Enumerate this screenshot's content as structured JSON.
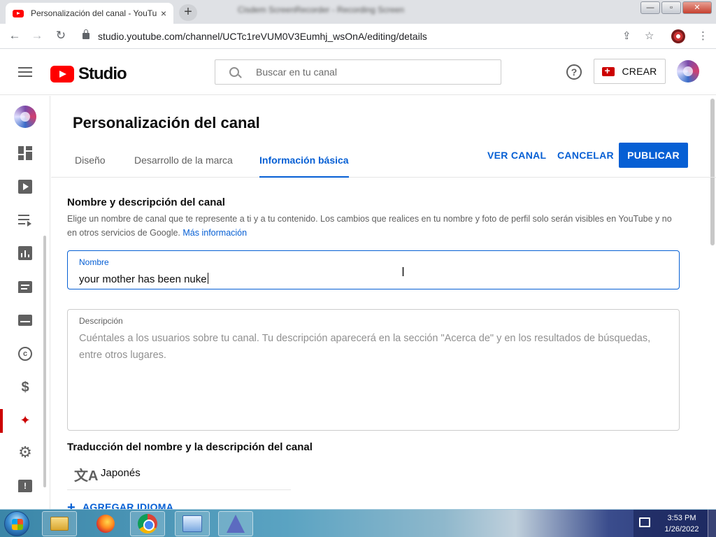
{
  "browser": {
    "tab_title": "Personalización del canal - YouTube",
    "tab_close": "×",
    "new_tab": "+",
    "window_title": "Cisdem ScreenRecorder - Recording Screen",
    "win_min": "—",
    "win_max": "▫",
    "win_close": "✕",
    "back": "←",
    "forward": "→",
    "reload": "↻",
    "url": "studio.youtube.com/channel/UCTc1reVUM0V3Eumhj_wsOnA/editing/details",
    "share_icon": "⇪",
    "star_icon": "☆",
    "menu_icon": "⋮"
  },
  "header": {
    "logo_text": "Studio",
    "search_placeholder": "Buscar en tu canal",
    "help": "?",
    "create_label": "CREAR"
  },
  "rail": {
    "items": [
      {
        "name": "panel",
        "icon": "dashboard-icon"
      },
      {
        "name": "contenido",
        "icon": "content-icon"
      },
      {
        "name": "listas",
        "icon": "playlists-icon"
      },
      {
        "name": "estadisticas",
        "icon": "analytics-icon"
      },
      {
        "name": "comentarios",
        "icon": "comments-icon"
      },
      {
        "name": "subtitulos",
        "icon": "subtitles-icon"
      },
      {
        "name": "derechos",
        "icon": "copyright-icon",
        "glyph": "c"
      },
      {
        "name": "ingresos",
        "icon": "monetization-icon",
        "glyph": "$"
      },
      {
        "name": "personalizacion",
        "icon": "customization-icon",
        "active": true,
        "glyph": "✦"
      },
      {
        "name": "configuracion",
        "icon": "settings-icon",
        "glyph": "⚙"
      },
      {
        "name": "comentarios-enviar",
        "icon": "feedback-icon",
        "glyph": "!"
      }
    ]
  },
  "page": {
    "title": "Personalización del canal",
    "tabs": [
      {
        "label": "Diseño",
        "active": false
      },
      {
        "label": "Desarrollo de la marca",
        "active": false
      },
      {
        "label": "Información básica",
        "active": true
      }
    ],
    "actions": {
      "view_channel": "VER CANAL",
      "cancel": "CANCELAR",
      "publish": "PUBLICAR"
    },
    "section": {
      "title": "Nombre y descripción del canal",
      "description": "Elige un nombre de canal que te represente a ti y a tu contenido. Los cambios que realices en tu nombre y foto de perfil solo serán visibles en YouTube y no en otros servicios de Google.",
      "link": "Más información"
    },
    "name_field": {
      "label": "Nombre",
      "value": "your mother has been nuke"
    },
    "description_field": {
      "label": "Descripción",
      "placeholder": "Cuéntales a los usuarios sobre tu canal. Tu descripción aparecerá en la sección \"Acerca de\" y en los resultados de búsquedas, entre otros lugares."
    },
    "translation": {
      "title": "Traducción del nombre y la descripción del canal",
      "icon_glyph": "文A",
      "language": "Japonés",
      "add_language": "AGREGAR IDIOMA",
      "add_icon": "+"
    }
  },
  "taskbar": {
    "apps": [
      "explorer",
      "firefox",
      "chrome",
      "control-panel",
      "app"
    ],
    "time": "3:53 PM",
    "date": "1/26/2022"
  },
  "colors": {
    "accent": "#065fd4",
    "brand_red": "#ff0000",
    "active_rail": "#cc0000"
  }
}
